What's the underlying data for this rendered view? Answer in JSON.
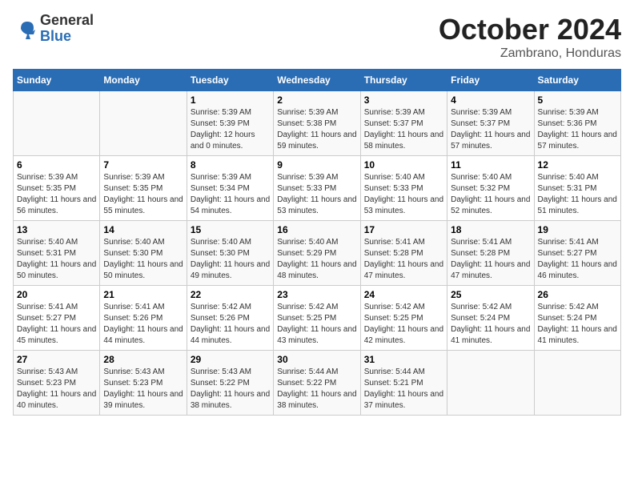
{
  "header": {
    "logo_general": "General",
    "logo_blue": "Blue",
    "month": "October 2024",
    "location": "Zambrano, Honduras"
  },
  "weekdays": [
    "Sunday",
    "Monday",
    "Tuesday",
    "Wednesday",
    "Thursday",
    "Friday",
    "Saturday"
  ],
  "weeks": [
    [
      {
        "day": "",
        "info": ""
      },
      {
        "day": "",
        "info": ""
      },
      {
        "day": "1",
        "sunrise": "5:39 AM",
        "sunset": "5:39 PM",
        "daylight": "12 hours and 0 minutes."
      },
      {
        "day": "2",
        "sunrise": "5:39 AM",
        "sunset": "5:38 PM",
        "daylight": "11 hours and 59 minutes."
      },
      {
        "day": "3",
        "sunrise": "5:39 AM",
        "sunset": "5:37 PM",
        "daylight": "11 hours and 58 minutes."
      },
      {
        "day": "4",
        "sunrise": "5:39 AM",
        "sunset": "5:37 PM",
        "daylight": "11 hours and 57 minutes."
      },
      {
        "day": "5",
        "sunrise": "5:39 AM",
        "sunset": "5:36 PM",
        "daylight": "11 hours and 57 minutes."
      }
    ],
    [
      {
        "day": "6",
        "sunrise": "5:39 AM",
        "sunset": "5:35 PM",
        "daylight": "11 hours and 56 minutes."
      },
      {
        "day": "7",
        "sunrise": "5:39 AM",
        "sunset": "5:35 PM",
        "daylight": "11 hours and 55 minutes."
      },
      {
        "day": "8",
        "sunrise": "5:39 AM",
        "sunset": "5:34 PM",
        "daylight": "11 hours and 54 minutes."
      },
      {
        "day": "9",
        "sunrise": "5:39 AM",
        "sunset": "5:33 PM",
        "daylight": "11 hours and 53 minutes."
      },
      {
        "day": "10",
        "sunrise": "5:40 AM",
        "sunset": "5:33 PM",
        "daylight": "11 hours and 53 minutes."
      },
      {
        "day": "11",
        "sunrise": "5:40 AM",
        "sunset": "5:32 PM",
        "daylight": "11 hours and 52 minutes."
      },
      {
        "day": "12",
        "sunrise": "5:40 AM",
        "sunset": "5:31 PM",
        "daylight": "11 hours and 51 minutes."
      }
    ],
    [
      {
        "day": "13",
        "sunrise": "5:40 AM",
        "sunset": "5:31 PM",
        "daylight": "11 hours and 50 minutes."
      },
      {
        "day": "14",
        "sunrise": "5:40 AM",
        "sunset": "5:30 PM",
        "daylight": "11 hours and 50 minutes."
      },
      {
        "day": "15",
        "sunrise": "5:40 AM",
        "sunset": "5:30 PM",
        "daylight": "11 hours and 49 minutes."
      },
      {
        "day": "16",
        "sunrise": "5:40 AM",
        "sunset": "5:29 PM",
        "daylight": "11 hours and 48 minutes."
      },
      {
        "day": "17",
        "sunrise": "5:41 AM",
        "sunset": "5:28 PM",
        "daylight": "11 hours and 47 minutes."
      },
      {
        "day": "18",
        "sunrise": "5:41 AM",
        "sunset": "5:28 PM",
        "daylight": "11 hours and 47 minutes."
      },
      {
        "day": "19",
        "sunrise": "5:41 AM",
        "sunset": "5:27 PM",
        "daylight": "11 hours and 46 minutes."
      }
    ],
    [
      {
        "day": "20",
        "sunrise": "5:41 AM",
        "sunset": "5:27 PM",
        "daylight": "11 hours and 45 minutes."
      },
      {
        "day": "21",
        "sunrise": "5:41 AM",
        "sunset": "5:26 PM",
        "daylight": "11 hours and 44 minutes."
      },
      {
        "day": "22",
        "sunrise": "5:42 AM",
        "sunset": "5:26 PM",
        "daylight": "11 hours and 44 minutes."
      },
      {
        "day": "23",
        "sunrise": "5:42 AM",
        "sunset": "5:25 PM",
        "daylight": "11 hours and 43 minutes."
      },
      {
        "day": "24",
        "sunrise": "5:42 AM",
        "sunset": "5:25 PM",
        "daylight": "11 hours and 42 minutes."
      },
      {
        "day": "25",
        "sunrise": "5:42 AM",
        "sunset": "5:24 PM",
        "daylight": "11 hours and 41 minutes."
      },
      {
        "day": "26",
        "sunrise": "5:42 AM",
        "sunset": "5:24 PM",
        "daylight": "11 hours and 41 minutes."
      }
    ],
    [
      {
        "day": "27",
        "sunrise": "5:43 AM",
        "sunset": "5:23 PM",
        "daylight": "11 hours and 40 minutes."
      },
      {
        "day": "28",
        "sunrise": "5:43 AM",
        "sunset": "5:23 PM",
        "daylight": "11 hours and 39 minutes."
      },
      {
        "day": "29",
        "sunrise": "5:43 AM",
        "sunset": "5:22 PM",
        "daylight": "11 hours and 38 minutes."
      },
      {
        "day": "30",
        "sunrise": "5:44 AM",
        "sunset": "5:22 PM",
        "daylight": "11 hours and 38 minutes."
      },
      {
        "day": "31",
        "sunrise": "5:44 AM",
        "sunset": "5:21 PM",
        "daylight": "11 hours and 37 minutes."
      },
      {
        "day": "",
        "info": ""
      },
      {
        "day": "",
        "info": ""
      }
    ]
  ]
}
